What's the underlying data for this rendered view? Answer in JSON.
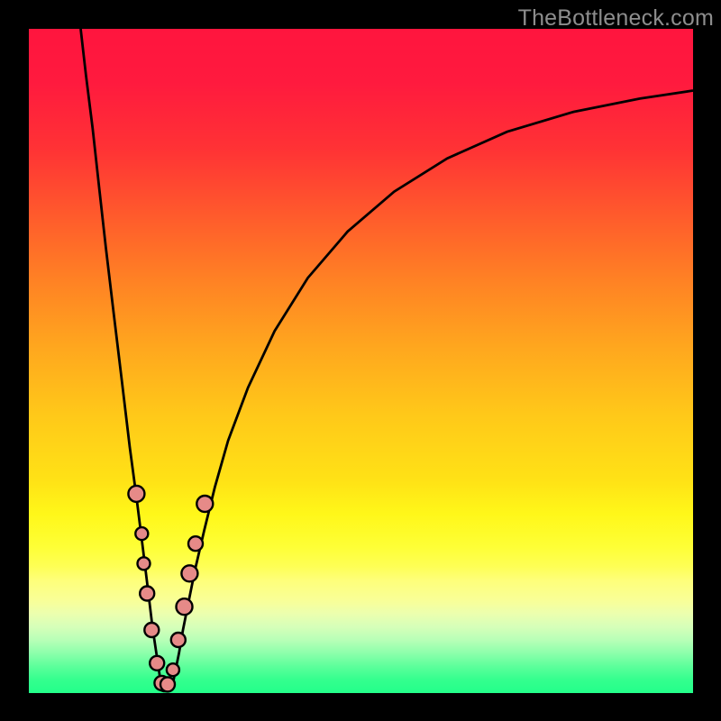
{
  "watermark": "TheBottleneck.com",
  "chart_data": {
    "type": "line",
    "title": "",
    "xlabel": "",
    "ylabel": "",
    "xlim": [
      0,
      100
    ],
    "ylim": [
      0,
      100
    ],
    "zero_x": 20,
    "curve_points": [
      {
        "x": 7.8,
        "y": 100.0
      },
      {
        "x": 8.6,
        "y": 93.0
      },
      {
        "x": 9.6,
        "y": 85.0
      },
      {
        "x": 10.6,
        "y": 76.0
      },
      {
        "x": 11.6,
        "y": 67.0
      },
      {
        "x": 12.8,
        "y": 57.0
      },
      {
        "x": 14.0,
        "y": 47.0
      },
      {
        "x": 15.2,
        "y": 37.0
      },
      {
        "x": 16.2,
        "y": 29.5
      },
      {
        "x": 17.2,
        "y": 21.5
      },
      {
        "x": 18.0,
        "y": 15.0
      },
      {
        "x": 18.6,
        "y": 10.0
      },
      {
        "x": 19.2,
        "y": 6.0
      },
      {
        "x": 19.8,
        "y": 2.0
      },
      {
        "x": 20.0,
        "y": 0.4
      },
      {
        "x": 20.3,
        "y": 0.3
      },
      {
        "x": 20.8,
        "y": 0.3
      },
      {
        "x": 21.2,
        "y": 0.4
      },
      {
        "x": 21.6,
        "y": 1.0
      },
      {
        "x": 22.0,
        "y": 3.0
      },
      {
        "x": 22.6,
        "y": 6.0
      },
      {
        "x": 23.2,
        "y": 9.5
      },
      {
        "x": 24.0,
        "y": 13.5
      },
      {
        "x": 25.0,
        "y": 18.5
      },
      {
        "x": 26.4,
        "y": 24.5
      },
      {
        "x": 28.0,
        "y": 31.0
      },
      {
        "x": 30.0,
        "y": 38.0
      },
      {
        "x": 33.0,
        "y": 46.0
      },
      {
        "x": 37.0,
        "y": 54.5
      },
      {
        "x": 42.0,
        "y": 62.5
      },
      {
        "x": 48.0,
        "y": 69.5
      },
      {
        "x": 55.0,
        "y": 75.5
      },
      {
        "x": 63.0,
        "y": 80.5
      },
      {
        "x": 72.0,
        "y": 84.5
      },
      {
        "x": 82.0,
        "y": 87.5
      },
      {
        "x": 92.0,
        "y": 89.5
      },
      {
        "x": 100.0,
        "y": 90.7
      }
    ],
    "dots": [
      {
        "x": 16.2,
        "y": 30.0,
        "r": 9
      },
      {
        "x": 17.0,
        "y": 24.0,
        "r": 7
      },
      {
        "x": 17.3,
        "y": 19.5,
        "r": 7
      },
      {
        "x": 17.8,
        "y": 15.0,
        "r": 8
      },
      {
        "x": 18.5,
        "y": 9.5,
        "r": 8
      },
      {
        "x": 19.3,
        "y": 4.5,
        "r": 8
      },
      {
        "x": 20.0,
        "y": 1.5,
        "r": 8
      },
      {
        "x": 20.9,
        "y": 1.3,
        "r": 8
      },
      {
        "x": 21.7,
        "y": 3.5,
        "r": 7
      },
      {
        "x": 22.5,
        "y": 8.0,
        "r": 8
      },
      {
        "x": 23.4,
        "y": 13.0,
        "r": 9
      },
      {
        "x": 24.2,
        "y": 18.0,
        "r": 9
      },
      {
        "x": 25.1,
        "y": 22.5,
        "r": 8
      },
      {
        "x": 26.5,
        "y": 28.5,
        "r": 9
      }
    ]
  }
}
